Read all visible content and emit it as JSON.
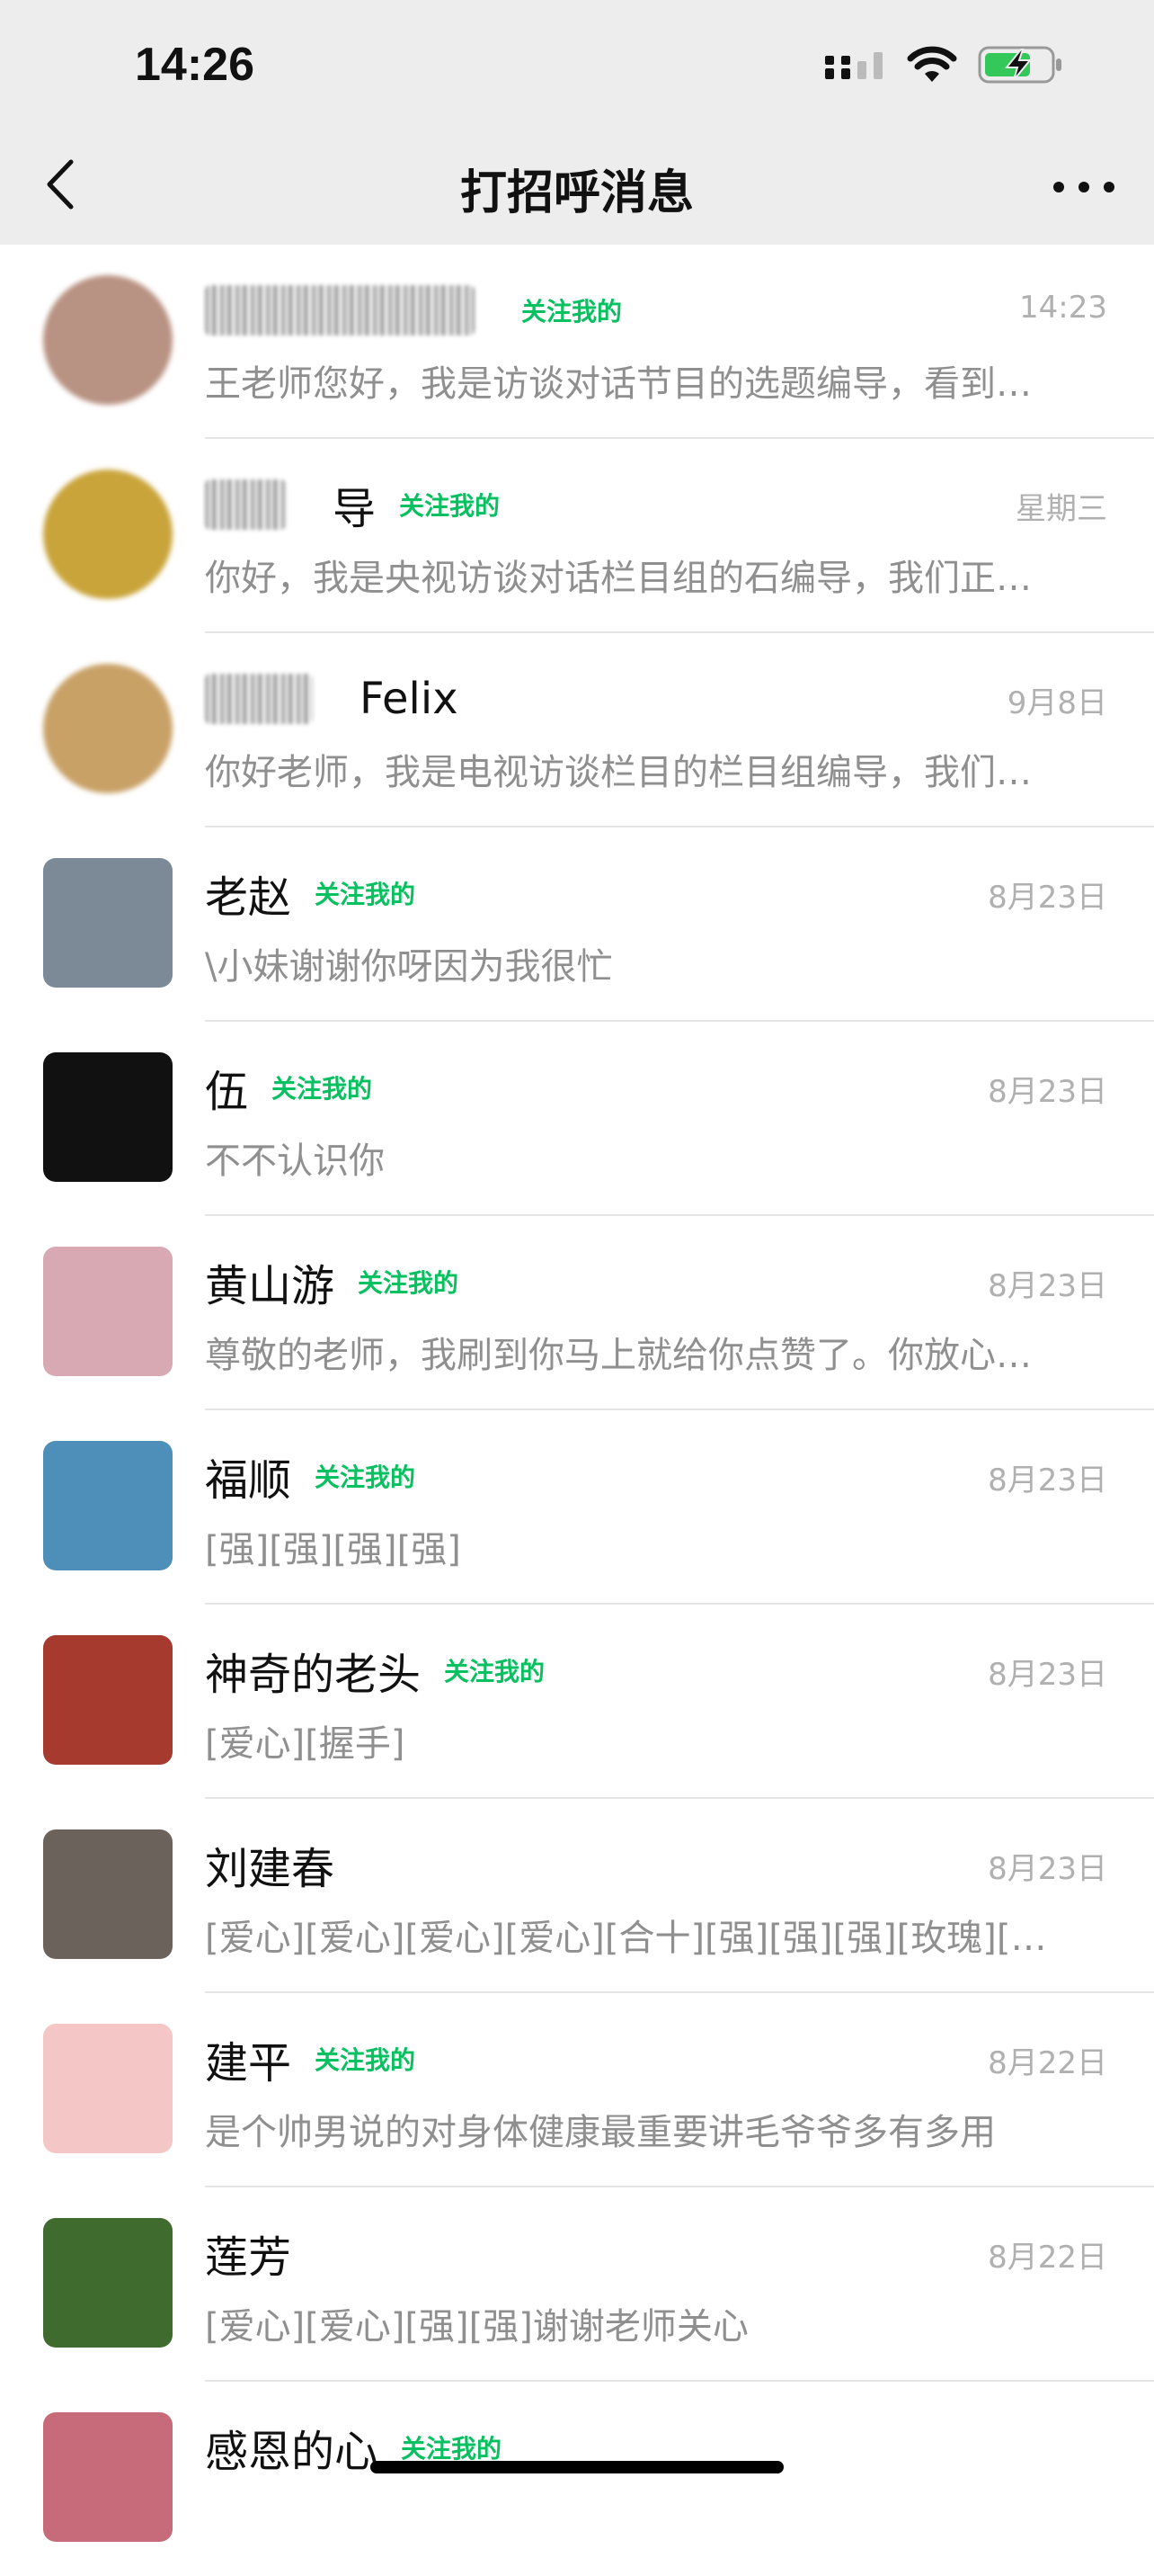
{
  "status": {
    "time": "14:26"
  },
  "nav": {
    "title": "打招呼消息"
  },
  "conversations": [
    {
      "name": "",
      "name_suffix": "",
      "follow": "关注我的",
      "time": "14:23",
      "message": "王老师您好，我是访谈对话节目的选题编导，看到…",
      "avatar_color": "#b89282"
    },
    {
      "name": "",
      "name_suffix": "导",
      "follow": "关注我的",
      "time": "星期三",
      "message": "你好，我是央视访谈对话栏目组的石编导，我们正…",
      "avatar_color": "#c9a43a"
    },
    {
      "name": "",
      "name_suffix": "Felix",
      "follow": "",
      "time": "9月8日",
      "message": "你好老师，我是电视访谈栏目的栏目组编导，我们…",
      "avatar_color": "#c8a167"
    },
    {
      "name": "老赵",
      "name_suffix": "",
      "follow": "关注我的",
      "time": "8月23日",
      "message": "\\小妹谢谢你呀因为我很忙",
      "avatar_color": "#7b8a96"
    },
    {
      "name": "伍",
      "name_suffix": "",
      "follow": "关注我的",
      "time": "8月23日",
      "message": "不不认识你",
      "avatar_color": "#111111"
    },
    {
      "name": "黄山游",
      "name_suffix": "",
      "follow": "关注我的",
      "time": "8月23日",
      "message": "尊敬的老师，我刷到你马上就给你点赞了。你放心…",
      "avatar_color": "#d9a9b3"
    },
    {
      "name": "福顺",
      "name_suffix": "",
      "follow": "关注我的",
      "time": "8月23日",
      "message": "[强][强][强][强]",
      "avatar_color": "#4d8fb8"
    },
    {
      "name": "神奇的老头",
      "name_suffix": "",
      "follow": "关注我的",
      "time": "8月23日",
      "message": "[爱心][握手]",
      "avatar_color": "#a63a2e"
    },
    {
      "name": "刘建春",
      "name_suffix": "",
      "follow": "",
      "time": "8月23日",
      "message": "[爱心][爱心][爱心][爱心][合十][强][强][强][玫瑰][…",
      "avatar_color": "#6b625c"
    },
    {
      "name": "建平",
      "name_suffix": "",
      "follow": "关注我的",
      "time": "8月22日",
      "message": "是个帅男说的对身体健康最重要讲毛爷爷多有多用",
      "avatar_color": "#f4c6c6"
    },
    {
      "name": "莲芳",
      "name_suffix": "",
      "follow": "",
      "time": "8月22日",
      "message": "[爱心][爱心][强][强]谢谢老师关心",
      "avatar_color": "#3f6b2e"
    },
    {
      "name": "感恩的心",
      "name_suffix": "",
      "follow": "关注我的",
      "time": "",
      "message": "",
      "avatar_color": "#c76b7a"
    }
  ]
}
